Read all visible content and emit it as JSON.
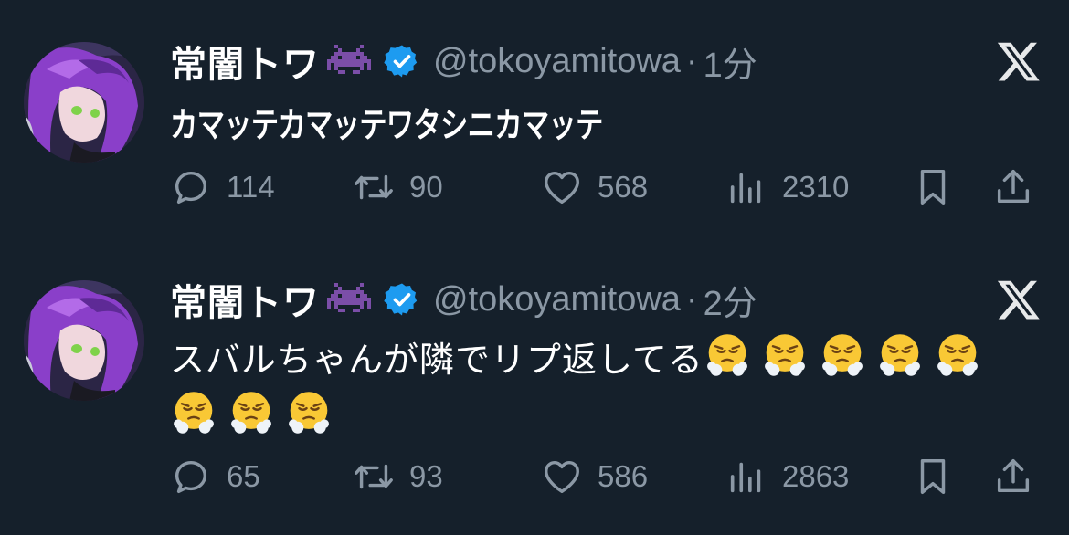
{
  "tweets": [
    {
      "display_name": "常闇トワ",
      "handle": "@tokoyamitowa",
      "separator": "·",
      "time": "1分",
      "text": "カマッテカマッテワタシニカマッテ",
      "emojis": [],
      "reply_count": "114",
      "retweet_count": "90",
      "like_count": "568",
      "view_count": "2310"
    },
    {
      "display_name": "常闇トワ",
      "handle": "@tokoyamitowa",
      "separator": "·",
      "time": "2分",
      "text": "スバルちゃんが隣でリプ返してる",
      "emojis": [
        "face-with-steam-from-nose",
        "face-with-steam-from-nose",
        "face-with-steam-from-nose",
        "face-with-steam-from-nose",
        "face-with-steam-from-nose",
        "face-with-steam-from-nose",
        "face-with-steam-from-nose",
        "face-with-steam-from-nose"
      ],
      "reply_count": "65",
      "retweet_count": "93",
      "like_count": "586",
      "view_count": "2863"
    }
  ],
  "icons": {
    "name_emoji": "alien-monster-icon",
    "verified": "verified-badge-icon",
    "platform": "x-logo-icon",
    "reply": "reply-icon",
    "retweet": "retweet-icon",
    "like": "heart-icon",
    "views": "views-icon",
    "bookmark": "bookmark-icon",
    "share": "share-icon"
  },
  "colors": {
    "background": "#15202b",
    "primary_text": "#ffffff",
    "secondary_text": "#8b98a5",
    "divider": "#38444d",
    "verified_blue": "#1d9bf0",
    "invader_purple": "#7b4ea8"
  }
}
